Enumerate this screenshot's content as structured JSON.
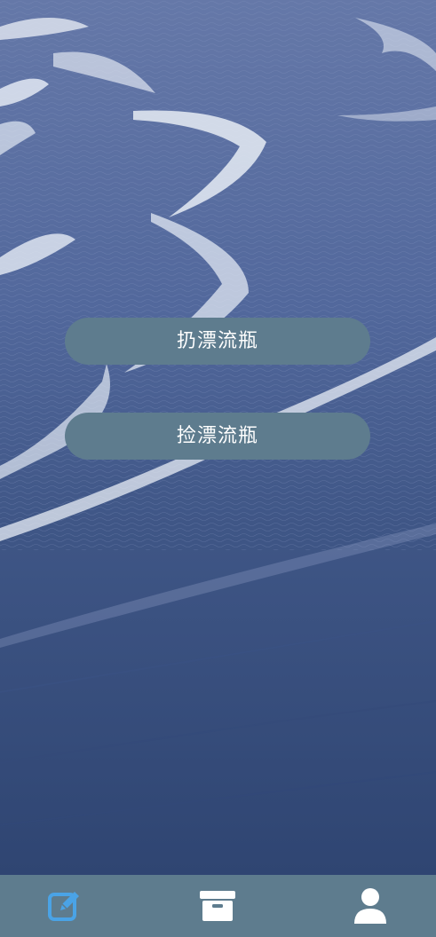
{
  "buttons": {
    "throw_label": "扔漂流瓶",
    "pick_label": "捡漂流瓶"
  },
  "tabbar": {
    "items": [
      {
        "icon": "edit-icon",
        "active": true
      },
      {
        "icon": "archive-box-icon",
        "active": false
      },
      {
        "icon": "user-icon",
        "active": false
      }
    ]
  },
  "colors": {
    "button_bg": "#5e7c8e",
    "tabbar_bg": "#5e7c8e",
    "active_icon": "#4aa3e6",
    "inactive_icon": "#ffffff",
    "sea_deep": "#2f4672",
    "foam": "#e8eef6"
  }
}
